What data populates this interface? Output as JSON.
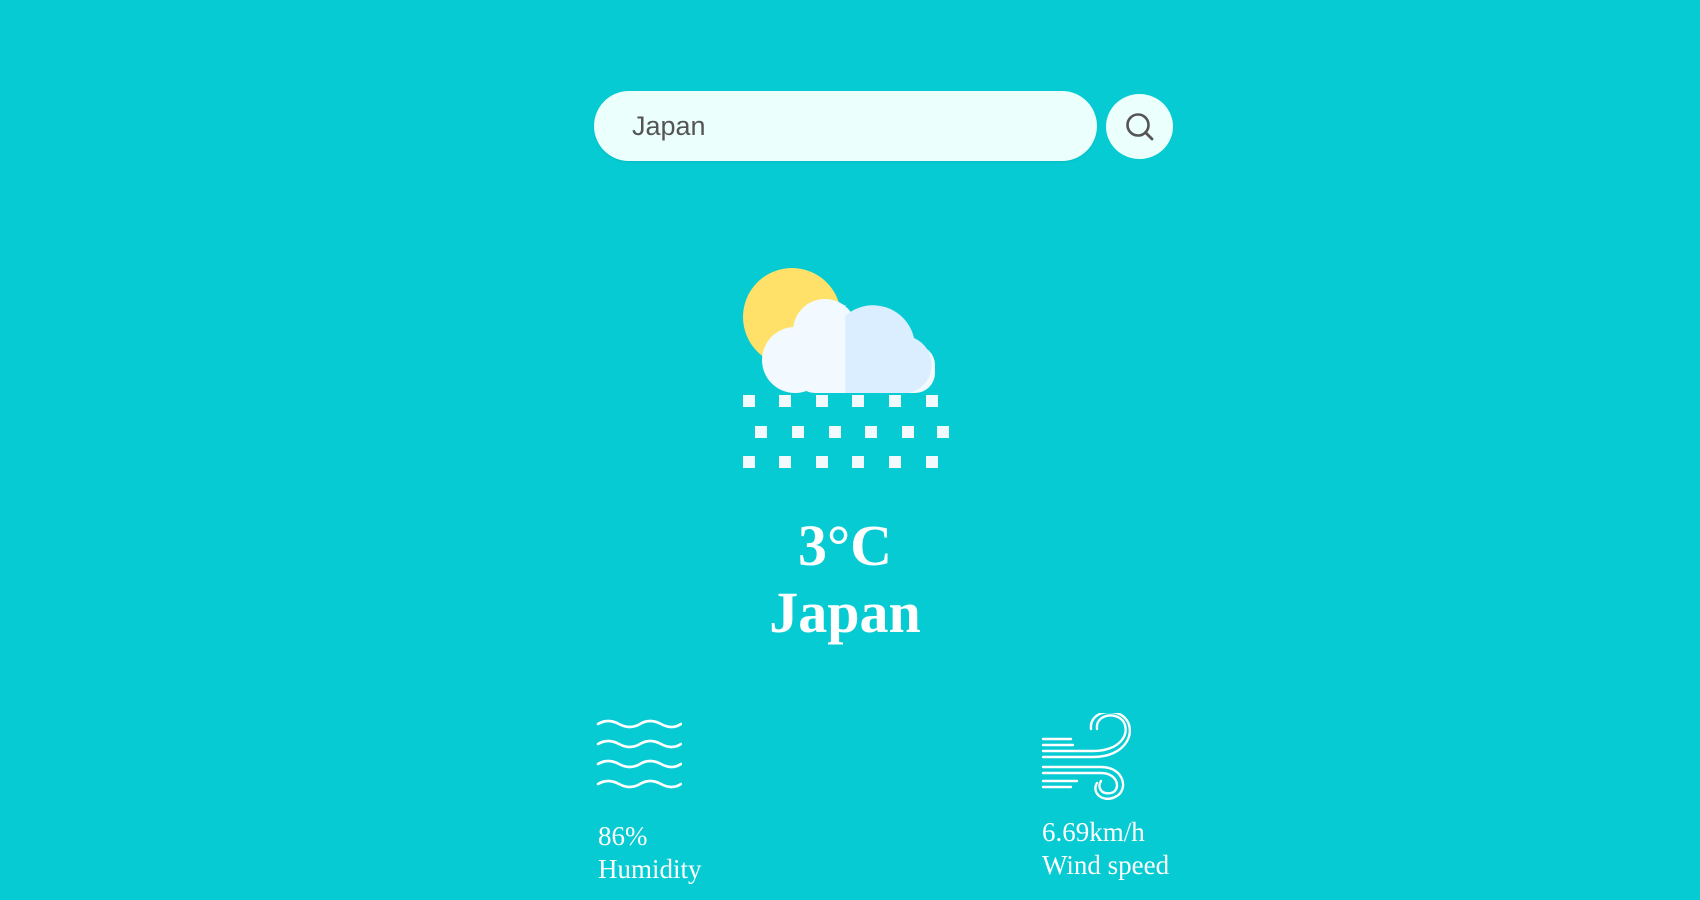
{
  "search": {
    "value": "Japan",
    "placeholder": "",
    "button_icon": "search-icon"
  },
  "weather": {
    "icon": "cloud-sun-snow-icon",
    "temperature": "3°C",
    "city": "Japan"
  },
  "details": {
    "humidity": {
      "icon": "humidity-waves-icon",
      "value": "86%",
      "label": "Humidity"
    },
    "wind": {
      "icon": "wind-icon",
      "value": "6.69km/h",
      "label": "Wind speed"
    }
  },
  "colors": {
    "background": "#06CBD3",
    "search_bg": "#EBFFFC",
    "text": "#FFFFFF",
    "sun": "#FFE169",
    "cloud_light": "#F3FAFF",
    "cloud_shade": "#DBEEFF"
  }
}
